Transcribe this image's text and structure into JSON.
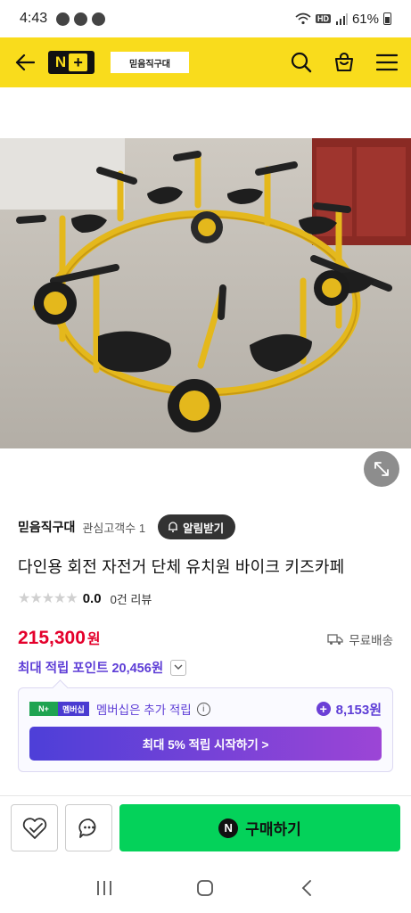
{
  "status_bar": {
    "time": "4:43",
    "battery": "61%",
    "network_label": "HD"
  },
  "header": {
    "logo_text": "N",
    "logo_plus": "+",
    "store_chip": "믿음직구대"
  },
  "product": {
    "store_name": "믿음직구대",
    "followers": "관심고객수 1",
    "alarm_button": "알림받기",
    "title": "다인용 회전 자전거 단체 유치원 바이크 키즈카페",
    "rating_score": "0.0",
    "review_count": "0건 리뷰",
    "stars": "★★★★★",
    "price": "215,300",
    "price_unit": "원",
    "shipping": "무료배송",
    "points_text": "최대 적립 포인트 20,456원"
  },
  "membership": {
    "badge_np": "N+",
    "badge_label": "멤버십",
    "text": "멤버십은 추가 적립",
    "info_icon": "i",
    "extra_points": "8,153원",
    "start_button": "최대 5% 적립 시작하기 >"
  },
  "bottom_bar": {
    "buy_logo": "N",
    "buy_button": "구매하기"
  },
  "colors": {
    "header_yellow": "#f9dc1c",
    "price_red": "#e4002b",
    "points_purple": "#5d3dd6",
    "buy_green": "#04d25a"
  }
}
